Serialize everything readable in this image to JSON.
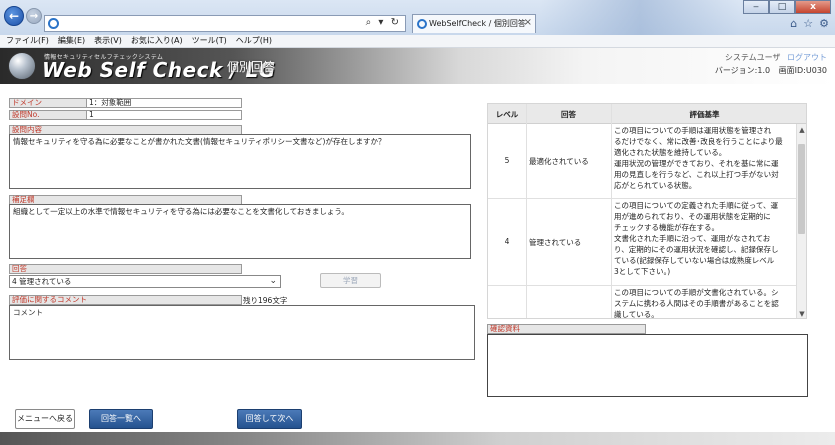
{
  "browser": {
    "address": "",
    "address_tools": "⌕ ▾ ↻",
    "tab_title": "WebSelfCheck / 個別回答",
    "tab_close": "×",
    "window_buttons": [
      "‒",
      "□",
      "x"
    ],
    "toolbar_icons": [
      "⌂",
      "☆",
      "⚙"
    ]
  },
  "menubar": [
    "ファイル(F)",
    "編集(E)",
    "表示(V)",
    "お気に入り(A)",
    "ツール(T)",
    "ヘルプ(H)"
  ],
  "header": {
    "logo_subtitle": "情報セキュリティセルフチェックシステム",
    "logo_text": "Web Self Check / LG",
    "page_title": "個別回答",
    "user": "システムユーザ",
    "logout": "ログアウト",
    "version": "バージョン:1.0",
    "screen_id": "画面ID:U030"
  },
  "form": {
    "domain_label": "ドメイン",
    "domain_value": "1：対象範囲",
    "question_no_label": "設問No.",
    "question_no_value": "1",
    "question_label": "設問内容",
    "question_text": "情報セキュリティを守る為に必要なことが書かれた文書(情報セキュリティポリシー文書など)が存在しますか？",
    "supplement_label": "補足欄",
    "supplement_text": "組織として一定以上の水準で情報セキュリティを守る為には必要なことを文書化しておきましょう。",
    "answer_label": "回答",
    "answer_value": "4 管理されている",
    "learn_button": "学習",
    "comment_label": "評価に関するコメント",
    "remaining_chars": "残り196文字",
    "comment_placeholder": "コメント"
  },
  "criteria": {
    "headers": [
      "レベル",
      "回答",
      "評価基準"
    ],
    "rows": [
      {
        "level": "5",
        "answer": "最適化されている",
        "lines": [
          "この項目についての手順は運用状態を管理され",
          "るだけでなく、常に改善･改良を行うことにより最",
          "適化された状態を維持している。",
          "運用状況の管理ができており、それを基に常に運",
          "用の見直しを行うなど、これ以上打つ手がない対",
          "応がとられている状態。"
        ]
      },
      {
        "level": "4",
        "answer": "管理されている",
        "lines": [
          "この項目についての定義された手順に従って、運",
          "用が進められており、その運用状態を定期的に",
          "チェックする機能が存在する。",
          "文書化された手順に沿って、運用がなされてお",
          "り、定期的にその運用状況を確認し、記録保存し",
          "ている(記録保存していない場合は成熟度レベル",
          "3として下さい。)"
        ]
      },
      {
        "level": "",
        "answer": "",
        "lines": [
          "この項目についての手順が文書化されている。シ",
          "ステムに携わる人間はその手順書があることを認",
          "識している。"
        ]
      }
    ],
    "scroll_up": "▲",
    "scroll_down": "▼",
    "docs_label": "確認資料"
  },
  "buttons": {
    "back_menu": "メニューへ戻る",
    "answer_list": "回答一覧へ",
    "answer_next": "回答して次へ"
  }
}
